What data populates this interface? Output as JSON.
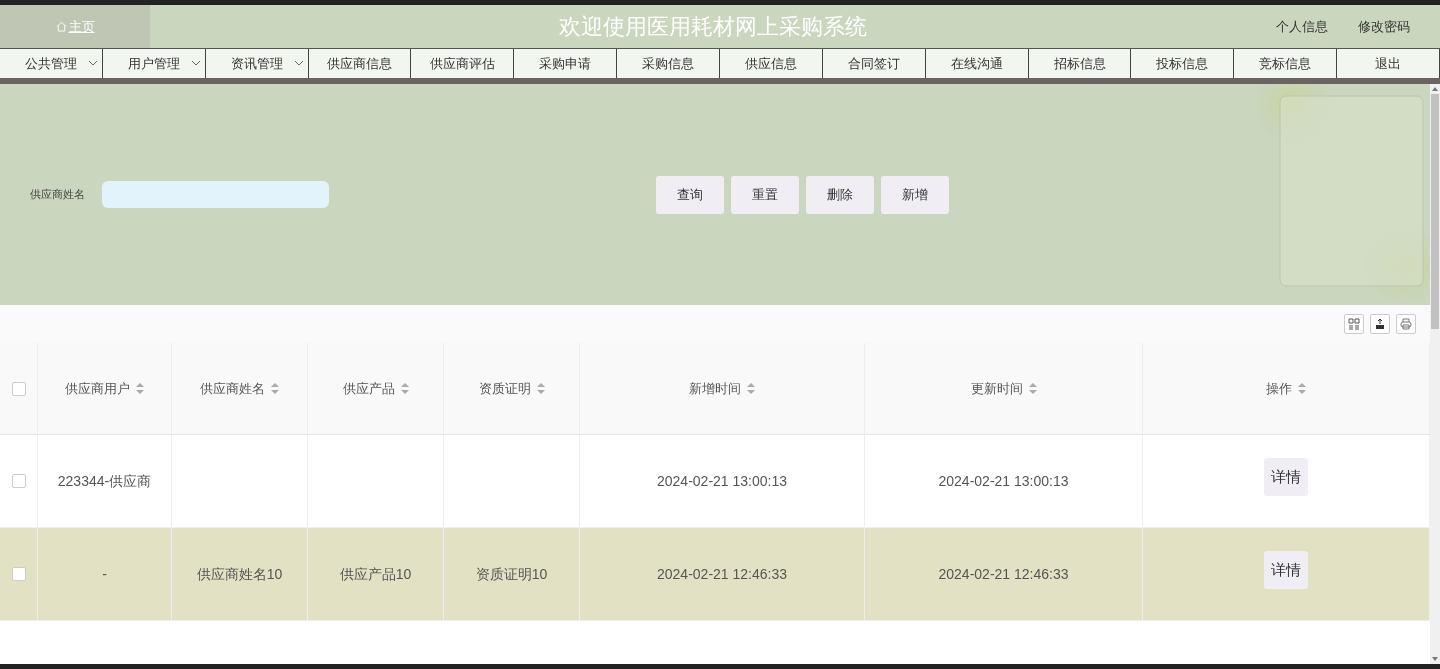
{
  "header": {
    "home": "主页",
    "title": "欢迎使用医用耗材网上采购系统",
    "links": [
      "个人信息",
      "修改密码"
    ]
  },
  "nav": [
    {
      "label": "公共管理",
      "dropdown": true
    },
    {
      "label": "用户管理",
      "dropdown": true
    },
    {
      "label": "资讯管理",
      "dropdown": true
    },
    {
      "label": "供应商信息",
      "dropdown": false
    },
    {
      "label": "供应商评估",
      "dropdown": false
    },
    {
      "label": "采购申请",
      "dropdown": false
    },
    {
      "label": "采购信息",
      "dropdown": false
    },
    {
      "label": "供应信息",
      "dropdown": false
    },
    {
      "label": "合同签订",
      "dropdown": false
    },
    {
      "label": "在线沟通",
      "dropdown": false
    },
    {
      "label": "招标信息",
      "dropdown": false
    },
    {
      "label": "投标信息",
      "dropdown": false
    },
    {
      "label": "竞标信息",
      "dropdown": false
    },
    {
      "label": "退出",
      "dropdown": false
    }
  ],
  "search": {
    "label": "供应商姓名",
    "buttons": [
      "查询",
      "重置",
      "删除",
      "新增"
    ]
  },
  "table": {
    "columns": [
      "供应商用户",
      "供应商姓名",
      "供应产品",
      "资质证明",
      "新增时间",
      "更新时间",
      "操作"
    ],
    "rows": [
      {
        "selected": false,
        "checked": false,
        "cells": [
          "223344-供应商",
          "",
          "",
          "",
          "2024-02-21 13:00:13",
          "2024-02-21 13:00:13"
        ],
        "action": "详情"
      },
      {
        "selected": true,
        "checked": false,
        "cells": [
          "-",
          "供应商姓名10",
          "供应产品10",
          "资质证明10",
          "2024-02-21 12:46:33",
          "2024-02-21 12:46:33"
        ],
        "action": "详情"
      }
    ],
    "select_all_checked": false
  }
}
